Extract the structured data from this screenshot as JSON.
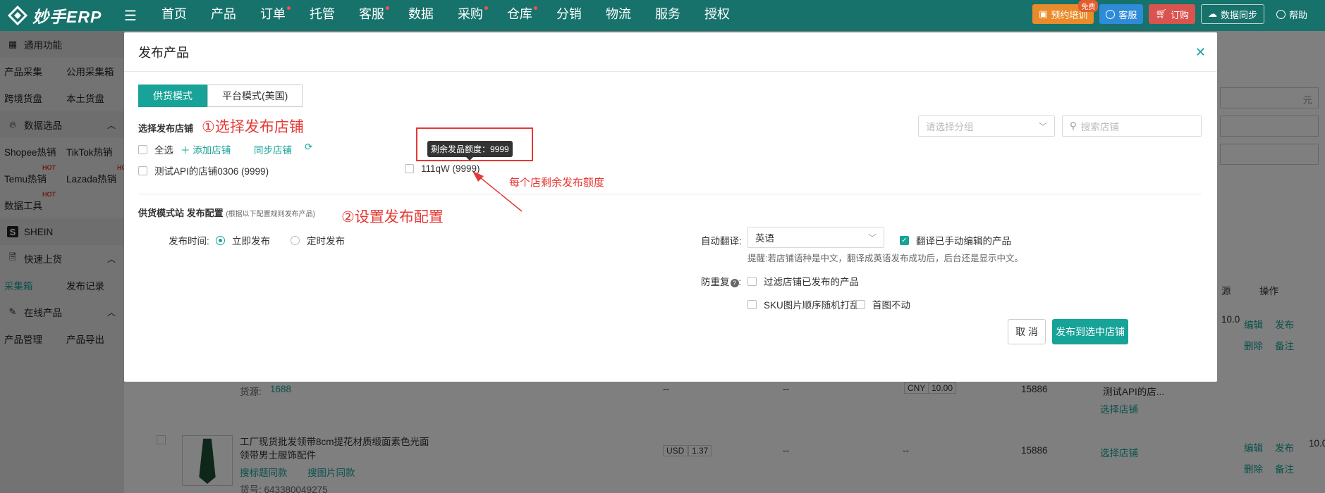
{
  "app": {
    "logo_text": "妙手ERP"
  },
  "nav": [
    {
      "label": "首页",
      "dot": false
    },
    {
      "label": "产品",
      "dot": false
    },
    {
      "label": "订单",
      "dot": true
    },
    {
      "label": "托管",
      "dot": false
    },
    {
      "label": "客服",
      "dot": true
    },
    {
      "label": "数据",
      "dot": false
    },
    {
      "label": "采购",
      "dot": true
    },
    {
      "label": "仓库",
      "dot": true
    },
    {
      "label": "分销",
      "dot": false
    },
    {
      "label": "物流",
      "dot": false
    },
    {
      "label": "服务",
      "dot": false
    },
    {
      "label": "授权",
      "dot": false
    }
  ],
  "topright": {
    "training": "预约培训",
    "training_badge": "免费",
    "service": "客服",
    "order": "订购",
    "sync": "数据同步",
    "help": "帮助"
  },
  "sidebar": {
    "common": "通用功能",
    "product_collect": "产品采集",
    "public_collect": "公用采集箱",
    "cross_border": "跨境货盘",
    "local": "本土货盘",
    "data_select": "数据选品",
    "shopee_hot": "Shopee热销",
    "tiktok_hot": "TikTok热销",
    "temu_hot": "Temu热销",
    "lazada_hot": "Lazada热销",
    "data_tools": "数据工具",
    "hot_tag": "HOT",
    "shein": "SHEIN",
    "quick_upload": "快速上货",
    "collect_box": "采集箱",
    "publish_record": "发布记录",
    "online_products": "在线产品",
    "product_manage": "产品管理",
    "product_export": "产品导出"
  },
  "background": {
    "yuan": "元",
    "source": "源",
    "operation": "操作",
    "source_label": "货源:",
    "source_value": "1688",
    "dash": "--",
    "cny": "CNY",
    "cny_value": "10.00",
    "stock": "15886",
    "store_name": "测试API的店...",
    "choose_store": "选择店铺",
    "edit": "编辑",
    "publish": "发布",
    "delete": "删除",
    "note": "备注",
    "product_title": "工厂现货批发领带8cm提花材质缎面素色光面领带男士服饰配件",
    "search_title_same": "搜标题同款",
    "search_image_same": "搜图片同款",
    "goods_no": "货号: 643380049275",
    "usd": "USD",
    "usd_value": "1.37",
    "ten": "10.0"
  },
  "modal": {
    "title": "发布产品",
    "tabs": [
      "供货模式",
      "平台模式(美国)"
    ],
    "select_store_title": "选择发布店铺",
    "annotation1": "①选择发布店铺",
    "select_all": "全选",
    "add_store": "添加店铺",
    "sync_store": "同步店铺",
    "group_placeholder": "请选择分组",
    "search_placeholder": "搜索店铺",
    "stores": [
      {
        "name": "测试API的店铺0306 (9999)",
        "checked": false
      },
      {
        "name": "111qW (9999)",
        "checked": false
      }
    ],
    "tooltip": "剩余发品额度：9999",
    "annotation_quota": "每个店剩余发布额度",
    "config_title": "供货模式站 发布配置",
    "config_sub": "(根据以下配置规则发布产品)",
    "annotation2": "②设置发布配置",
    "publish_time_label": "发布时间:",
    "publish_now": "立即发布",
    "publish_timed": "定时发布",
    "auto_translate_label": "自动翻译:",
    "language": "英语",
    "translate_edited": "翻译已手动编辑的产品",
    "translate_hint": "提醒:若店铺语种是中文，翻译成英语发布成功后，后台还是显示中文。",
    "anti_dup_label": "防重复",
    "filter_published": "过滤店铺已发布的产品",
    "sku_random": "SKU图片顺序随机打乱",
    "first_img_fixed": "首图不动",
    "cancel": "取 消",
    "publish_selected": "发布到选中店铺"
  }
}
